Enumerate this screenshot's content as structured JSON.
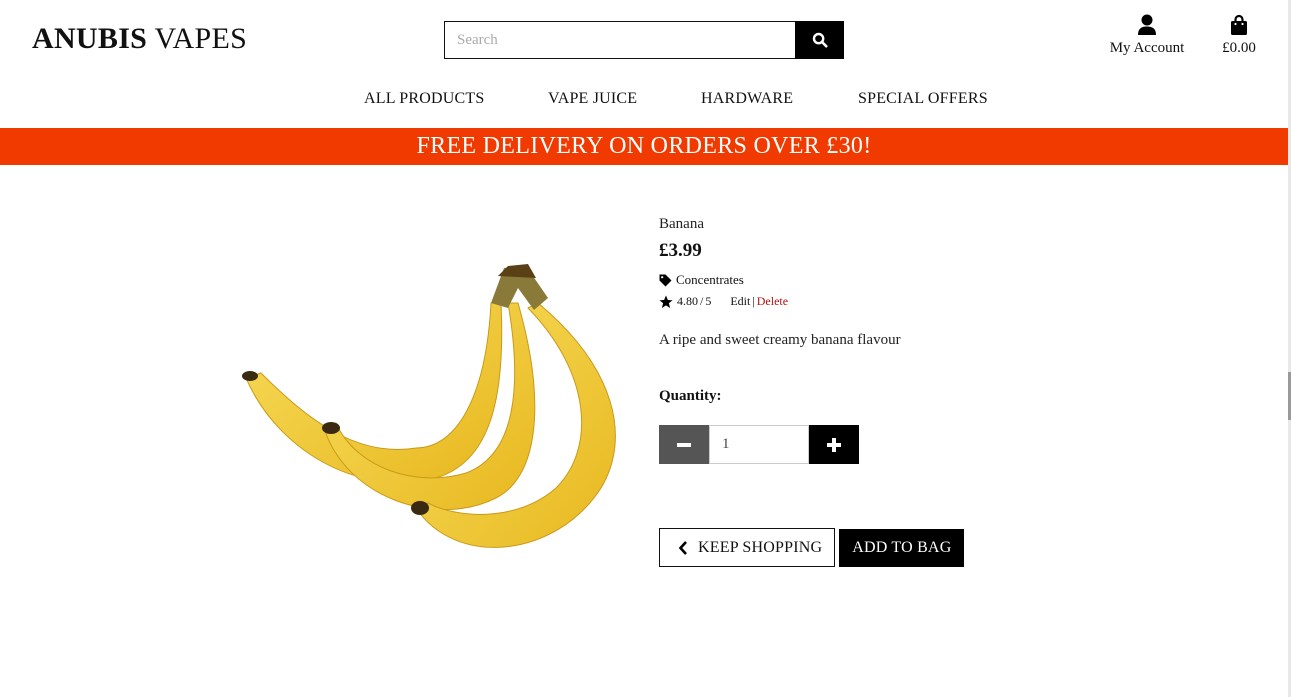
{
  "brand": {
    "part1": "ANUBIS",
    "part2": "VAPES"
  },
  "search": {
    "placeholder": "Search",
    "value": "",
    "icon": "search-icon"
  },
  "account": {
    "label": "My Account",
    "icon": "user-icon"
  },
  "bag": {
    "total": "£0.00",
    "icon": "shopping-bag-icon"
  },
  "nav": {
    "items": [
      {
        "label": "ALL PRODUCTS"
      },
      {
        "label": "VAPE JUICE"
      },
      {
        "label": "HARDWARE"
      },
      {
        "label": "SPECIAL OFFERS"
      }
    ]
  },
  "banner": {
    "text": "FREE DELIVERY ON ORDERS OVER £30!"
  },
  "colors": {
    "accent": "#f03a00",
    "delete_link": "#b4120e",
    "button_dark": "#000000",
    "button_grey": "#555555"
  },
  "product": {
    "name": "Banana",
    "price": "£3.99",
    "category": "Concentrates",
    "category_icon": "tag-icon",
    "rating": "4.80",
    "rating_max": "5",
    "rating_sep": "/",
    "rating_icon": "star-icon",
    "edit_label": "Edit",
    "link_sep": "|",
    "delete_label": "Delete",
    "description": "A ripe and sweet creamy banana flavour",
    "image_icon": "banana-product-image"
  },
  "quantity": {
    "label": "Quantity:",
    "value": "1",
    "minus_icon": "minus-icon",
    "plus_icon": "plus-icon"
  },
  "actions": {
    "keep_shopping": "KEEP SHOPPING",
    "keep_icon": "chevron-left-icon",
    "add_to_bag": "ADD TO BAG"
  }
}
